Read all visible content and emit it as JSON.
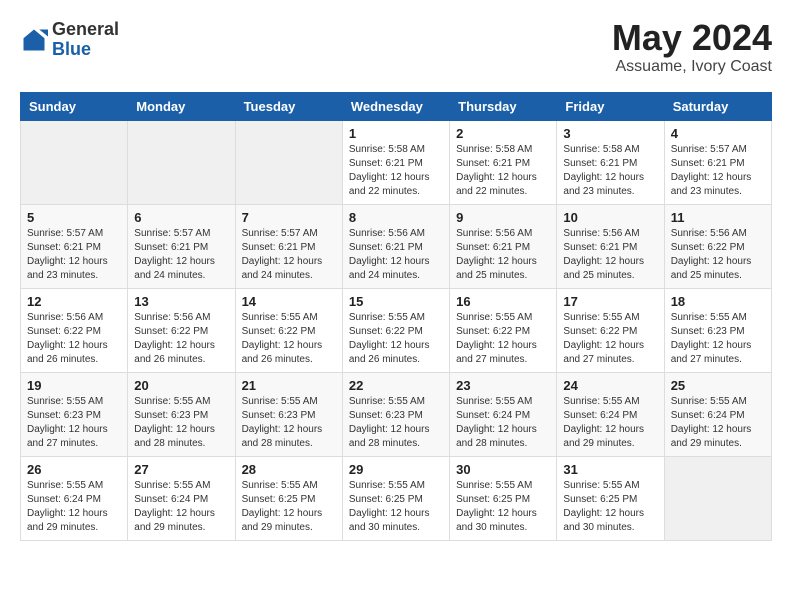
{
  "header": {
    "logo_general": "General",
    "logo_blue": "Blue",
    "title": "May 2024",
    "subtitle": "Assuame, Ivory Coast"
  },
  "days_of_week": [
    "Sunday",
    "Monday",
    "Tuesday",
    "Wednesday",
    "Thursday",
    "Friday",
    "Saturday"
  ],
  "weeks": [
    [
      {
        "day": "",
        "info": ""
      },
      {
        "day": "",
        "info": ""
      },
      {
        "day": "",
        "info": ""
      },
      {
        "day": "1",
        "info": "Sunrise: 5:58 AM\nSunset: 6:21 PM\nDaylight: 12 hours and 22 minutes."
      },
      {
        "day": "2",
        "info": "Sunrise: 5:58 AM\nSunset: 6:21 PM\nDaylight: 12 hours and 22 minutes."
      },
      {
        "day": "3",
        "info": "Sunrise: 5:58 AM\nSunset: 6:21 PM\nDaylight: 12 hours and 23 minutes."
      },
      {
        "day": "4",
        "info": "Sunrise: 5:57 AM\nSunset: 6:21 PM\nDaylight: 12 hours and 23 minutes."
      }
    ],
    [
      {
        "day": "5",
        "info": "Sunrise: 5:57 AM\nSunset: 6:21 PM\nDaylight: 12 hours and 23 minutes."
      },
      {
        "day": "6",
        "info": "Sunrise: 5:57 AM\nSunset: 6:21 PM\nDaylight: 12 hours and 24 minutes."
      },
      {
        "day": "7",
        "info": "Sunrise: 5:57 AM\nSunset: 6:21 PM\nDaylight: 12 hours and 24 minutes."
      },
      {
        "day": "8",
        "info": "Sunrise: 5:56 AM\nSunset: 6:21 PM\nDaylight: 12 hours and 24 minutes."
      },
      {
        "day": "9",
        "info": "Sunrise: 5:56 AM\nSunset: 6:21 PM\nDaylight: 12 hours and 25 minutes."
      },
      {
        "day": "10",
        "info": "Sunrise: 5:56 AM\nSunset: 6:21 PM\nDaylight: 12 hours and 25 minutes."
      },
      {
        "day": "11",
        "info": "Sunrise: 5:56 AM\nSunset: 6:22 PM\nDaylight: 12 hours and 25 minutes."
      }
    ],
    [
      {
        "day": "12",
        "info": "Sunrise: 5:56 AM\nSunset: 6:22 PM\nDaylight: 12 hours and 26 minutes."
      },
      {
        "day": "13",
        "info": "Sunrise: 5:56 AM\nSunset: 6:22 PM\nDaylight: 12 hours and 26 minutes."
      },
      {
        "day": "14",
        "info": "Sunrise: 5:55 AM\nSunset: 6:22 PM\nDaylight: 12 hours and 26 minutes."
      },
      {
        "day": "15",
        "info": "Sunrise: 5:55 AM\nSunset: 6:22 PM\nDaylight: 12 hours and 26 minutes."
      },
      {
        "day": "16",
        "info": "Sunrise: 5:55 AM\nSunset: 6:22 PM\nDaylight: 12 hours and 27 minutes."
      },
      {
        "day": "17",
        "info": "Sunrise: 5:55 AM\nSunset: 6:22 PM\nDaylight: 12 hours and 27 minutes."
      },
      {
        "day": "18",
        "info": "Sunrise: 5:55 AM\nSunset: 6:23 PM\nDaylight: 12 hours and 27 minutes."
      }
    ],
    [
      {
        "day": "19",
        "info": "Sunrise: 5:55 AM\nSunset: 6:23 PM\nDaylight: 12 hours and 27 minutes."
      },
      {
        "day": "20",
        "info": "Sunrise: 5:55 AM\nSunset: 6:23 PM\nDaylight: 12 hours and 28 minutes."
      },
      {
        "day": "21",
        "info": "Sunrise: 5:55 AM\nSunset: 6:23 PM\nDaylight: 12 hours and 28 minutes."
      },
      {
        "day": "22",
        "info": "Sunrise: 5:55 AM\nSunset: 6:23 PM\nDaylight: 12 hours and 28 minutes."
      },
      {
        "day": "23",
        "info": "Sunrise: 5:55 AM\nSunset: 6:24 PM\nDaylight: 12 hours and 28 minutes."
      },
      {
        "day": "24",
        "info": "Sunrise: 5:55 AM\nSunset: 6:24 PM\nDaylight: 12 hours and 29 minutes."
      },
      {
        "day": "25",
        "info": "Sunrise: 5:55 AM\nSunset: 6:24 PM\nDaylight: 12 hours and 29 minutes."
      }
    ],
    [
      {
        "day": "26",
        "info": "Sunrise: 5:55 AM\nSunset: 6:24 PM\nDaylight: 12 hours and 29 minutes."
      },
      {
        "day": "27",
        "info": "Sunrise: 5:55 AM\nSunset: 6:24 PM\nDaylight: 12 hours and 29 minutes."
      },
      {
        "day": "28",
        "info": "Sunrise: 5:55 AM\nSunset: 6:25 PM\nDaylight: 12 hours and 29 minutes."
      },
      {
        "day": "29",
        "info": "Sunrise: 5:55 AM\nSunset: 6:25 PM\nDaylight: 12 hours and 30 minutes."
      },
      {
        "day": "30",
        "info": "Sunrise: 5:55 AM\nSunset: 6:25 PM\nDaylight: 12 hours and 30 minutes."
      },
      {
        "day": "31",
        "info": "Sunrise: 5:55 AM\nSunset: 6:25 PM\nDaylight: 12 hours and 30 minutes."
      },
      {
        "day": "",
        "info": ""
      }
    ]
  ]
}
